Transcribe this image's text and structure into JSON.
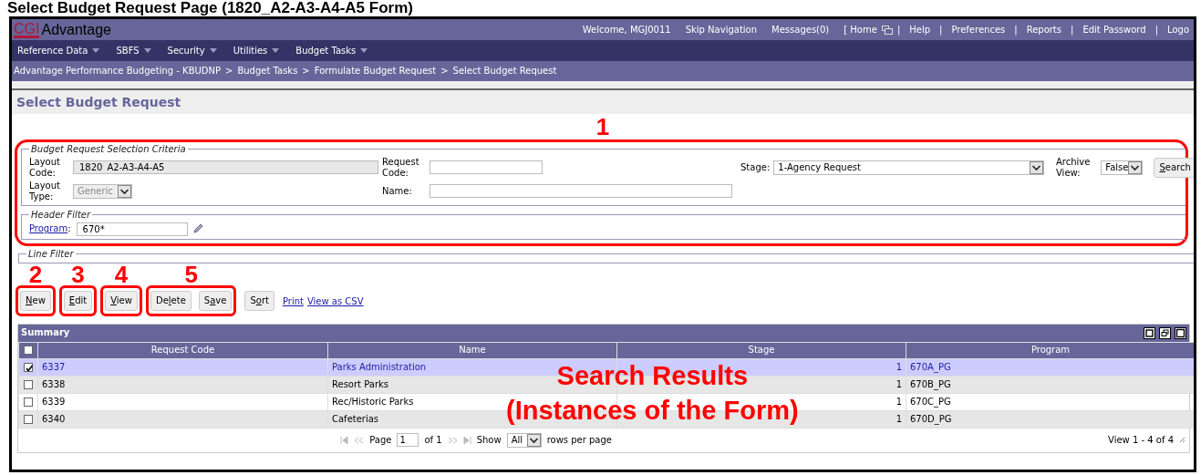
{
  "doc_title": "Select Budget Request Page (1820_A2-A3-A4-A5 Form)",
  "header": {
    "logo_mark": "CGI",
    "logo_text": "Advantage",
    "info_links": [
      "Welcome, MGJ0011",
      "Skip Navigation",
      "Messages(0)"
    ],
    "home_link": "[ Home",
    "separator": "|",
    "utility_links": [
      "Help",
      "Preferences",
      "Reports",
      "Edit Password",
      "Logo"
    ]
  },
  "menu": [
    "Reference Data",
    "SBFS",
    "Security",
    "Utilities",
    "Budget Tasks"
  ],
  "breadcrumb": {
    "separator": ">",
    "items": [
      "Advantage Performance Budgeting - KBUDNP",
      "Budget Tasks",
      "Formulate Budget Request",
      "Select Budget Request"
    ]
  },
  "page_title": "Select Budget Request",
  "criteria": {
    "callout": "1",
    "legend": "Budget Request Selection Criteria",
    "layout_code": {
      "label": "Layout Code:",
      "value": "1820_A2-A3-A4-A5",
      "disabled": true
    },
    "layout_type": {
      "label": "Layout Type:",
      "value": "Generic",
      "disabled": true
    },
    "request_code": {
      "label": "Request Code:"
    },
    "name": {
      "label": "Name:"
    },
    "stage": {
      "label": "Stage:",
      "value": "1-Agency Request"
    },
    "archive_view": {
      "label": "Archive View:",
      "value": "False"
    },
    "search_button": {
      "label": "Search"
    }
  },
  "header_filter": {
    "legend": "Header Filter",
    "program": {
      "label": "Program",
      "suffix": ":",
      "value": "670*"
    }
  },
  "line_filter": {
    "legend": "Line Filter"
  },
  "actions": {
    "groups": [
      {
        "callout": "2",
        "buttons": [
          {
            "label": "New"
          }
        ]
      },
      {
        "callout": "3",
        "buttons": [
          {
            "label": "Edit"
          }
        ]
      },
      {
        "callout": "4",
        "buttons": [
          {
            "label": "View"
          }
        ]
      },
      {
        "callout": "5",
        "buttons": [
          {
            "label": "Delete"
          },
          {
            "label": "Save"
          }
        ]
      },
      {
        "buttons": [
          {
            "label": "Sort"
          }
        ]
      }
    ],
    "links": [
      "Print",
      "View as CSV"
    ]
  },
  "summary": {
    "title": "Summary",
    "all_selected": false,
    "columns": [
      "Request Code",
      "Name",
      "Stage",
      "Program"
    ],
    "rows": [
      {
        "selected": true,
        "code": "6337",
        "name": "Parks Administration",
        "stage": "1",
        "program": "670A_PG"
      },
      {
        "selected": false,
        "code": "6338",
        "name": "Resort Parks",
        "stage": "1",
        "program": "670B_PG"
      },
      {
        "selected": false,
        "code": "6339",
        "name": "Rec/Historic Parks",
        "stage": "1",
        "program": "670C_PG"
      },
      {
        "selected": false,
        "code": "6340",
        "name": "Cafeterias",
        "stage": "1",
        "program": "670D_PG"
      }
    ],
    "pager": {
      "page_label": "Page",
      "page_value": "1",
      "page_total": "of 1",
      "show_label": "Show",
      "rows_value": "All",
      "rows_label": "rows per page",
      "view_info": "View 1 - 4 of 4"
    },
    "overlay": [
      "Search Results",
      "(Instances of the Form)"
    ]
  }
}
